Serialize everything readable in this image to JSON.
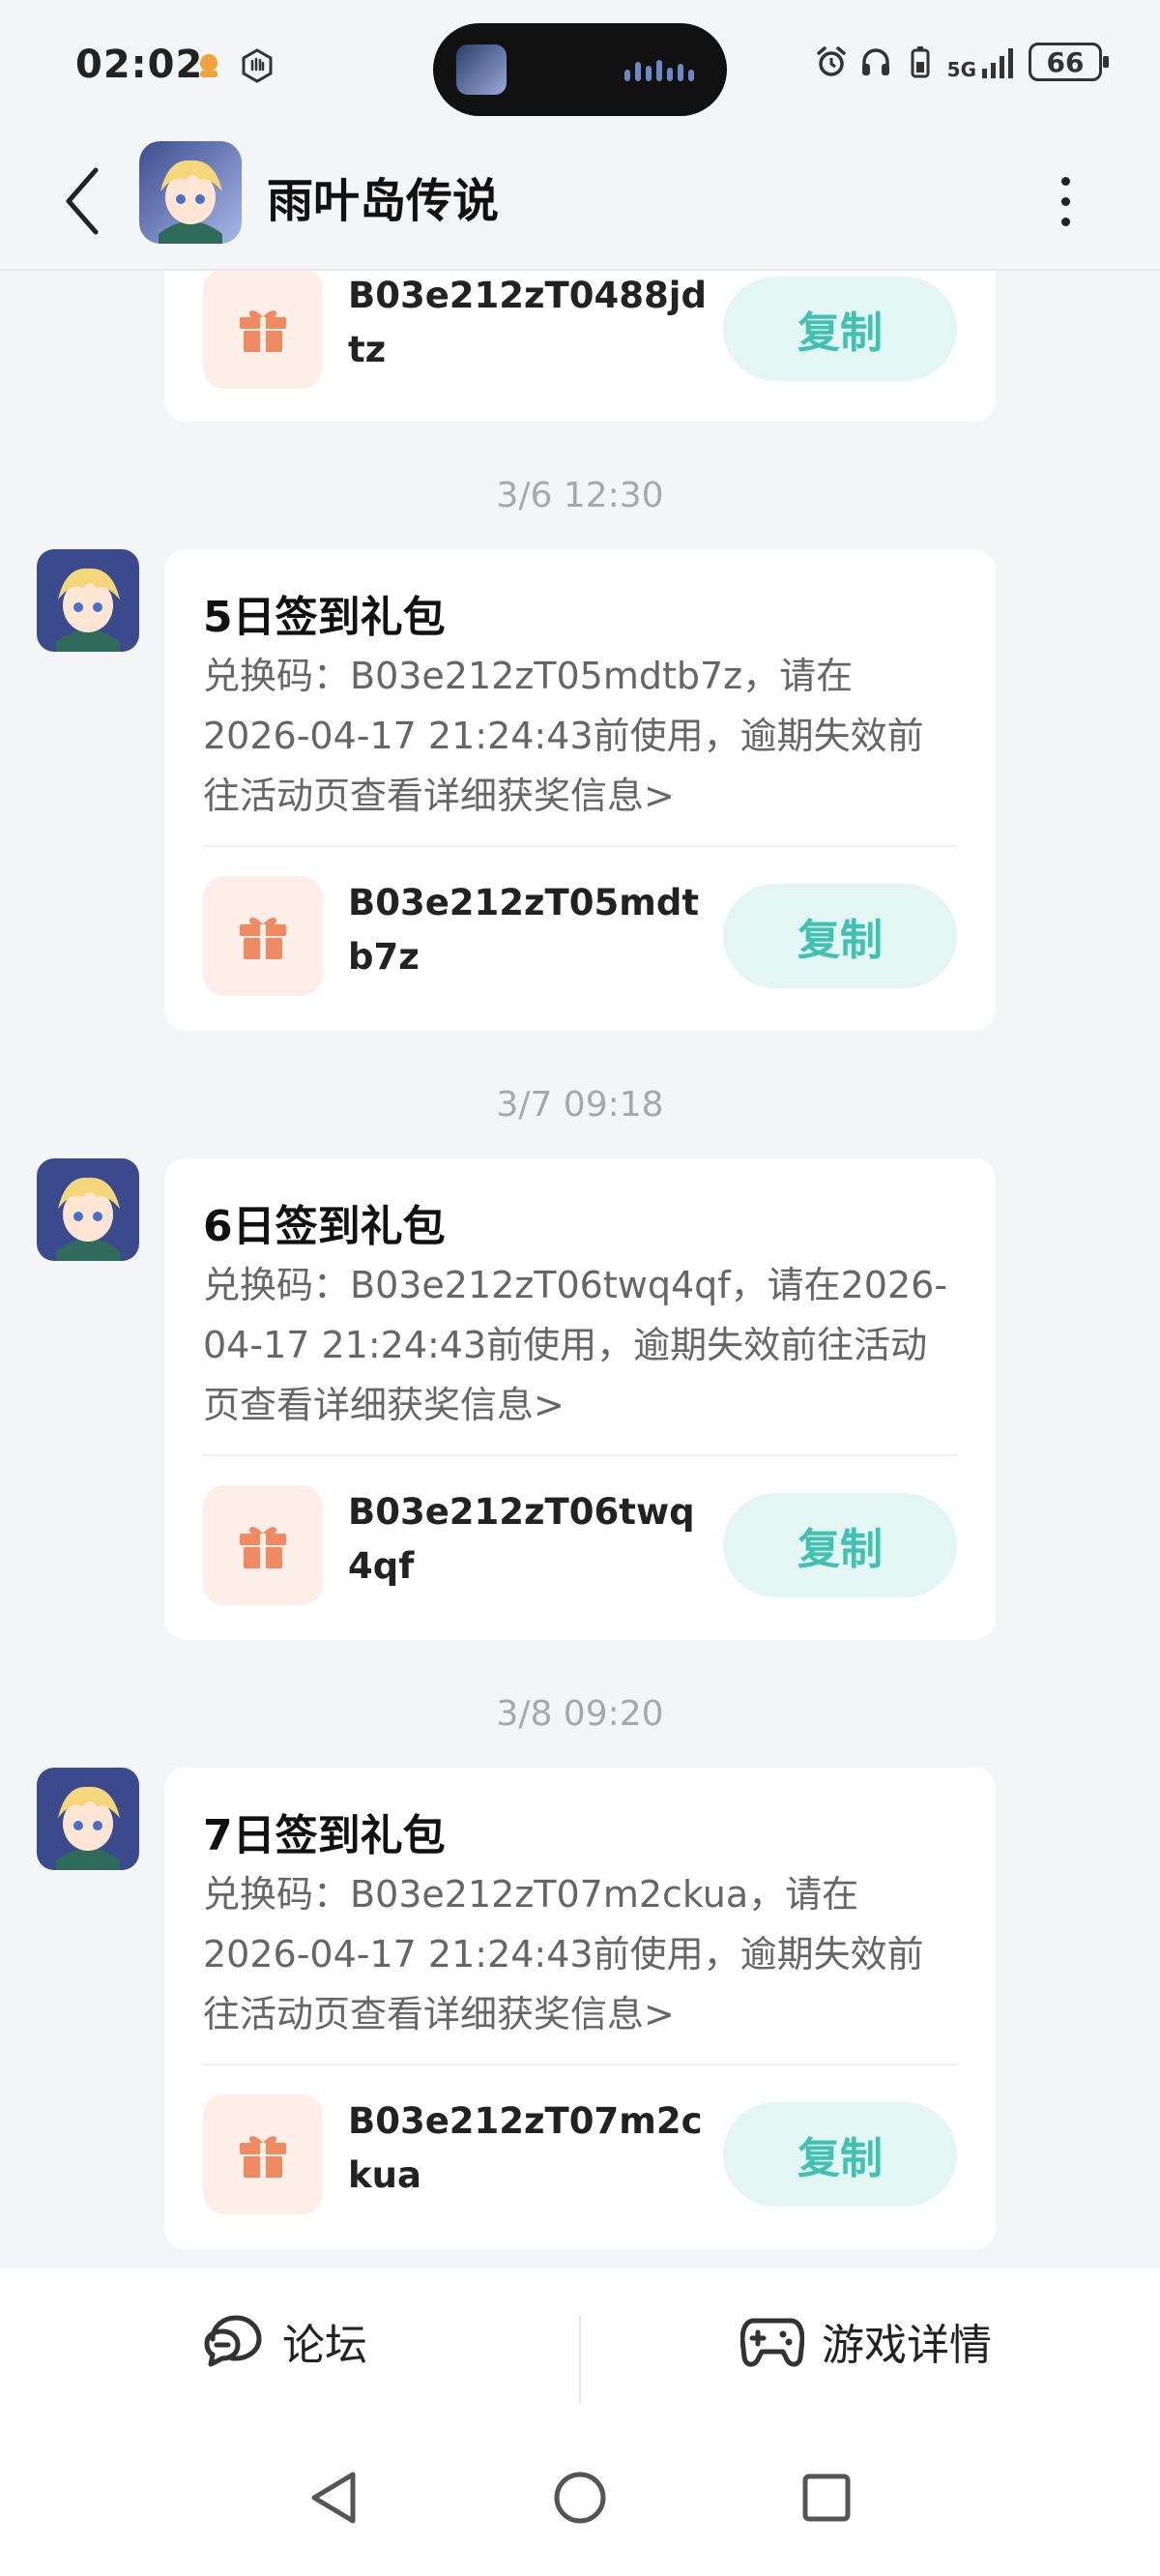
{
  "status_bar": {
    "time": "02:02",
    "battery": "66",
    "network": "5G"
  },
  "header": {
    "title": "雨叶岛传说",
    "back_icon": "chevron-left-icon",
    "more_icon": "more-vertical-icon"
  },
  "messages": [
    {
      "partial": true,
      "code": "B03e212zT0488jdtz",
      "copy_label": "复制"
    },
    {
      "time": "3/6  12:30",
      "title": "5日签到礼包",
      "body": "兑换码：B03e212zT05mdtb7z，请在2026-04-17 21:24:43前使用，逾期失效前往活动页查看详细获奖信息>",
      "code": "B03e212zT05mdtb7z",
      "copy_label": "复制"
    },
    {
      "time": "3/7  09:18",
      "title": "6日签到礼包",
      "body": "兑换码：B03e212zT06twq4qf，请在2026-04-17 21:24:43前使用，逾期失效前往活动页查看详细获奖信息>",
      "code": "B03e212zT06twq4qf",
      "copy_label": "复制"
    },
    {
      "time": "3/8  09:20",
      "title": "7日签到礼包",
      "body": "兑换码：B03e212zT07m2ckua，请在2026-04-17 21:24:43前使用，逾期失效前往活动页查看详细获奖信息>",
      "code": "B03e212zT07m2ckua",
      "copy_label": "复制"
    }
  ],
  "bottom_tabs": [
    {
      "label": "论坛",
      "icon": "forum-icon"
    },
    {
      "label": "游戏详情",
      "icon": "gamepad-icon"
    }
  ],
  "nav": {
    "back": "nav-back-icon",
    "home": "nav-home-icon",
    "recents": "nav-recents-icon"
  },
  "colors": {
    "accent_teal": "#3fc2b0",
    "copy_bg": "#e4f6f4",
    "gift_bg": "#fdeee8",
    "gift_icon": "#ef8a63"
  }
}
